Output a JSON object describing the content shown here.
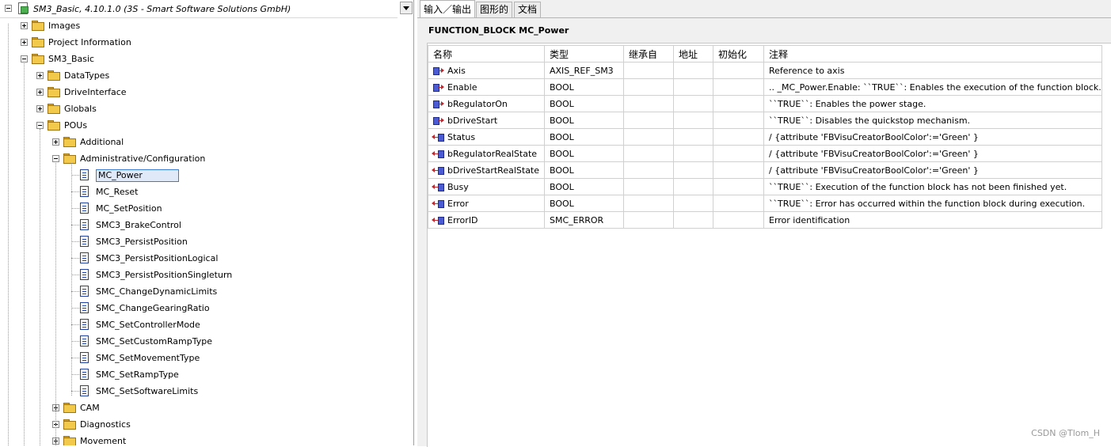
{
  "tree": {
    "root_title": "SM3_Basic, 4.10.1.0 (3S - Smart Software Solutions GmbH)",
    "items": [
      {
        "label": "Images",
        "icon": "folder-icon"
      },
      {
        "label": "Project Information",
        "icon": "folder-icon"
      },
      {
        "label": "SM3_Basic",
        "icon": "folder-icon"
      },
      {
        "label": "DataTypes",
        "icon": "folder-icon"
      },
      {
        "label": "DriveInterface",
        "icon": "folder-icon"
      },
      {
        "label": "Globals",
        "icon": "folder-icon"
      },
      {
        "label": "POUs",
        "icon": "folder-icon"
      },
      {
        "label": "Additional",
        "icon": "folder-icon"
      },
      {
        "label": "Administrative/Configuration",
        "icon": "folder-icon"
      },
      {
        "label": "MC_Power",
        "icon": "document-icon"
      },
      {
        "label": "MC_Reset",
        "icon": "document-icon"
      },
      {
        "label": "MC_SetPosition",
        "icon": "document-icon"
      },
      {
        "label": "SMC3_BrakeControl",
        "icon": "document-icon"
      },
      {
        "label": "SMC3_PersistPosition",
        "icon": "document-icon"
      },
      {
        "label": "SMC3_PersistPositionLogical",
        "icon": "document-icon"
      },
      {
        "label": "SMC3_PersistPositionSingleturn",
        "icon": "document-icon"
      },
      {
        "label": "SMC_ChangeDynamicLimits",
        "icon": "document-icon"
      },
      {
        "label": "SMC_ChangeGearingRatio",
        "icon": "document-icon"
      },
      {
        "label": "SMC_SetControllerMode",
        "icon": "document-icon"
      },
      {
        "label": "SMC_SetCustomRampType",
        "icon": "document-icon"
      },
      {
        "label": "SMC_SetMovementType",
        "icon": "document-icon"
      },
      {
        "label": "SMC_SetRampType",
        "icon": "document-icon"
      },
      {
        "label": "SMC_SetSoftwareLimits",
        "icon": "document-icon"
      },
      {
        "label": "CAM",
        "icon": "folder-icon"
      },
      {
        "label": "Diagnostics",
        "icon": "folder-icon"
      },
      {
        "label": "Movement",
        "icon": "folder-icon"
      }
    ],
    "selected": "MC_Power"
  },
  "tabs": [
    {
      "label": "输入／输出",
      "active": true
    },
    {
      "label": "图形的",
      "active": false
    },
    {
      "label": "文档",
      "active": false
    }
  ],
  "declaration": {
    "header": "FUNCTION_BLOCK  MC_Power",
    "columns": [
      "名称",
      "类型",
      "继承自",
      "地址",
      "初始化",
      "注释"
    ],
    "rows": [
      {
        "kind": "input",
        "name": "Axis",
        "type": "AXIS_REF_SM3",
        "inherited": "",
        "address": "",
        "init": "",
        "comment": "Reference to axis"
      },
      {
        "kind": "input",
        "name": "Enable",
        "type": "BOOL",
        "inherited": "",
        "address": "",
        "init": "",
        "comment": ".. _MC_Power.Enable:    ``TRUE``: Enables the execution of the function block."
      },
      {
        "kind": "input",
        "name": "bRegulatorOn",
        "type": "BOOL",
        "inherited": "",
        "address": "",
        "init": "",
        "comment": "``TRUE``: Enables the power stage."
      },
      {
        "kind": "input",
        "name": "bDriveStart",
        "type": "BOOL",
        "inherited": "",
        "address": "",
        "init": "",
        "comment": "``TRUE``: Disables the quickstop mechanism."
      },
      {
        "kind": "output",
        "name": "Status",
        "type": "BOOL",
        "inherited": "",
        "address": "",
        "init": "",
        "comment": "/ {attribute 'FBVisuCreatorBoolColor':='Green' }"
      },
      {
        "kind": "output",
        "name": "bRegulatorRealState",
        "type": "BOOL",
        "inherited": "",
        "address": "",
        "init": "",
        "comment": "/ {attribute 'FBVisuCreatorBoolColor':='Green' }"
      },
      {
        "kind": "output",
        "name": "bDriveStartRealState",
        "type": "BOOL",
        "inherited": "",
        "address": "",
        "init": "",
        "comment": "/ {attribute 'FBVisuCreatorBoolColor':='Green' }"
      },
      {
        "kind": "output",
        "name": "Busy",
        "type": "BOOL",
        "inherited": "",
        "address": "",
        "init": "",
        "comment": "``TRUE``: Execution of the function block has not been finished yet."
      },
      {
        "kind": "output",
        "name": "Error",
        "type": "BOOL",
        "inherited": "",
        "address": "",
        "init": "",
        "comment": "``TRUE``: Error has occurred within the function block during execution."
      },
      {
        "kind": "output",
        "name": "ErrorID",
        "type": "SMC_ERROR",
        "inherited": "",
        "address": "",
        "init": "",
        "comment": "Error identification"
      }
    ]
  },
  "watermark": "CSDN @Tlom_H",
  "colors": {
    "selection_border": "#3a7bd5",
    "folder": "#f3c94c",
    "input_arrow": "#c0272d",
    "var_box": "#4a5bd4"
  }
}
